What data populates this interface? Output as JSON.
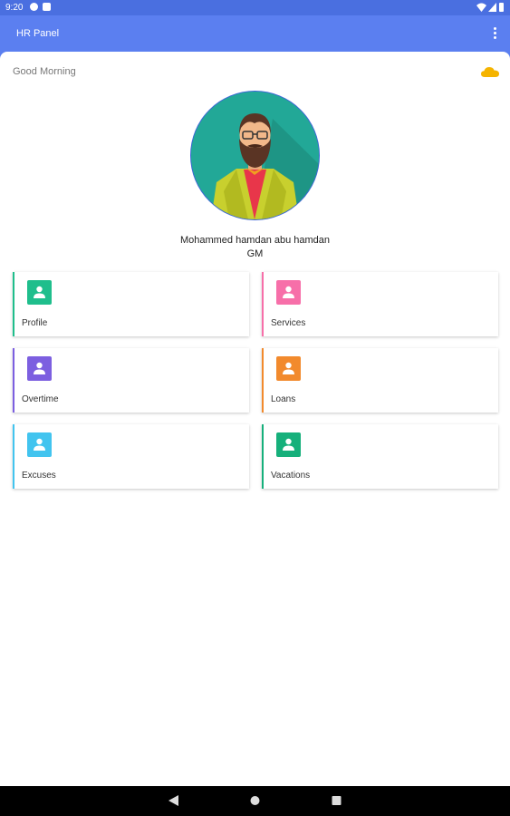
{
  "status": {
    "time": "9:20"
  },
  "appbar": {
    "title": "HR Panel"
  },
  "greeting": "Good Morning",
  "user": {
    "name": "Mohammed hamdan abu hamdan",
    "role": "GM"
  },
  "cards": [
    {
      "label": "Profile",
      "color": "#1fbe8c"
    },
    {
      "label": "Services",
      "color": "#f76fa9"
    },
    {
      "label": "Overtime",
      "color": "#7c5fe0"
    },
    {
      "label": "Loans",
      "color": "#f28a2d"
    },
    {
      "label": "Excuses",
      "color": "#42c4ef"
    },
    {
      "label": "Vacations",
      "color": "#16b07b"
    }
  ]
}
